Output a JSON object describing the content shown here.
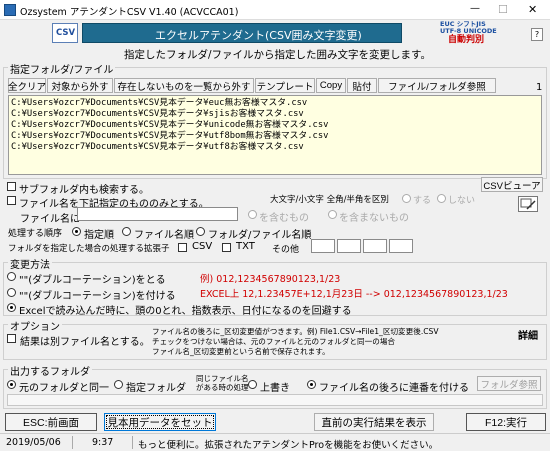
{
  "window": {
    "title": "Ozsystem アテンダントCSV V1.40 (ACVCCA01)",
    "min": "—",
    "max": "☐",
    "close": "✕"
  },
  "header": {
    "csv_icon": "CSV",
    "title": "エクセルアテンダント(CSV囲み文字変更)",
    "brand_line1": "EUC    シフトJIS",
    "brand_line2": "UTF-8   UNICODE",
    "brand_line3": "自動判別",
    "subtitle": "指定したフォルダ/ファイルから指定した囲み文字を変更します。"
  },
  "folder_section": {
    "label": "指定フォルダ/ファイル",
    "count": "1",
    "toolbar": [
      "全クリア",
      "対象から外す",
      "存在しないものを一覧から外す",
      "テンプレート",
      "Copy",
      "貼付",
      "ファイル/フォルダ参照"
    ],
    "files": [
      "C:¥Users¥ozcr7¥Documents¥CSV見本データ¥euc無お客様マスタ.csv",
      "C:¥Users¥ozcr7¥Documents¥CSV見本データ¥sjisお客様マスタ.csv",
      "C:¥Users¥ozcr7¥Documents¥CSV見本データ¥unicode無お客様マスタ.csv",
      "C:¥Users¥ozcr7¥Documents¥CSV見本データ¥utf8bom無お客様マスタ.csv",
      "C:¥Users¥ozcr7¥Documents¥CSV見本データ¥utf8お客様マスタ.csv"
    ]
  },
  "options": {
    "subfolder": "サブフォルダ内も検索する。",
    "filename_filter": "ファイル名を下記指定のもののみとする。",
    "case_label": "大文字/小文字 全角/半角を区別",
    "case_yes": "する",
    "case_no": "しない",
    "csv_viewer": "CSVビューア",
    "filename_label": "ファイル名に",
    "contains": "を含むもの",
    "not_contains": "を含まないもの",
    "order_label": "処理する順序",
    "order_options": [
      "指定順",
      "ファイル名順",
      "フォルダ/ファイル名順"
    ],
    "ext_label": "フォルダを指定した場合の処理する拡張子",
    "ext_csv": "CSV",
    "ext_txt": "TXT",
    "ext_other": "その他"
  },
  "method": {
    "label": "変更方法",
    "opt1": "\"\"(ダブルコーテーション)をとる",
    "opt2": "\"\"(ダブルコーテーション)を付ける",
    "opt3": "Excelで読み込んだ時に、頭の0とれ、指数表示、日付になるのを回避する",
    "ex1": "例) 012,1234567890123,1/23",
    "ex2": "EXCEL上 12,1.23457E+12,1月23日 --> 012,1234567890123,1/23"
  },
  "option_section": {
    "label": "オプション",
    "check": "結果は別ファイル名とする。",
    "desc1": "ファイル名の後ろに_区切変更値がつきます。例) File1.CSV→File1_区切変更後.CSV",
    "desc2": "チェックをつけない場合は、元のファイルと元のフォルダと同一の場合",
    "desc3": "ファイル名_区切変更前という名前で保存されます。",
    "detail": "詳細"
  },
  "output": {
    "label": "出力するフォルダ",
    "same": "元のフォルダと同一",
    "specified": "指定フォルダ",
    "dup_label_1": "同じファイル名",
    "dup_label_2": "がある時の処理",
    "overwrite": "上書き",
    "serial": "ファイル名の後ろに連番を付ける",
    "ref": "フォルダ参照"
  },
  "bottom": {
    "esc": "ESC:前画面",
    "sample": "見本用データをセット",
    "prev": "直前の実行結果を表示",
    "run": "F12:実行"
  },
  "status": {
    "date": "2019/05/06",
    "time": "9:37",
    "message": "もっと便利に。拡張されたアテンダントProを機能をお使いください。"
  }
}
